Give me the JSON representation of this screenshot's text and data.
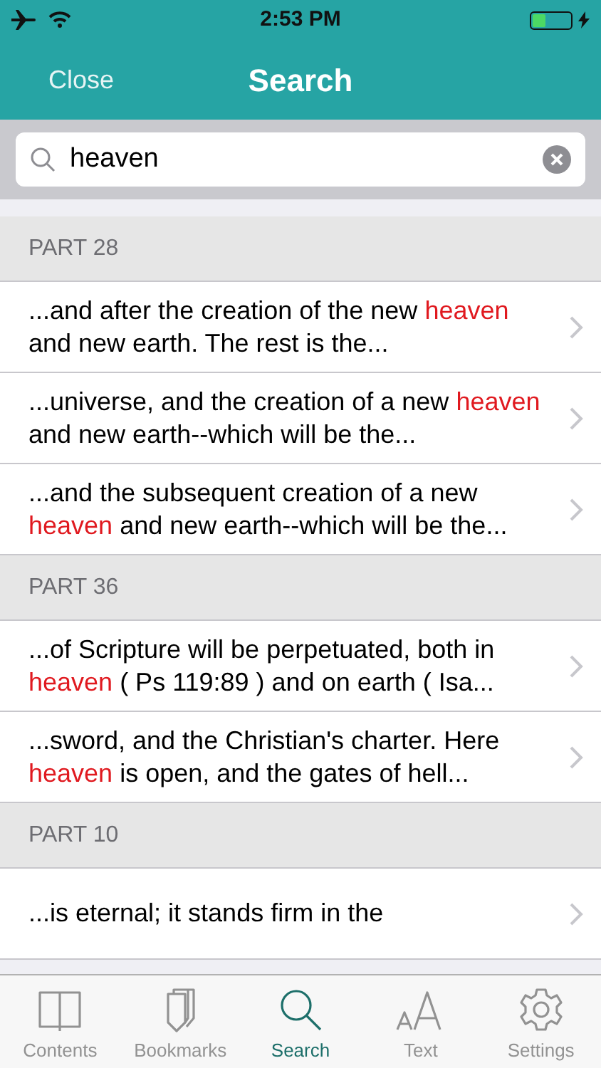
{
  "status_bar": {
    "time": "2:53 PM"
  },
  "nav": {
    "close": "Close",
    "title": "Search"
  },
  "search": {
    "value": "heaven"
  },
  "sections": [
    {
      "header": "PART 28",
      "results": [
        {
          "segments": [
            {
              "text": "...and after the creation of the new ",
              "highlight": false
            },
            {
              "text": "heaven",
              "highlight": true
            },
            {
              "text": " and new earth. The rest is the...",
              "highlight": false
            }
          ]
        },
        {
          "segments": [
            {
              "text": "...universe, and the creation of a new ",
              "highlight": false
            },
            {
              "text": "heaven",
              "highlight": true
            },
            {
              "text": " and new earth--which will be the...",
              "highlight": false
            }
          ]
        },
        {
          "segments": [
            {
              "text": "...and the subsequent creation of a new ",
              "highlight": false
            },
            {
              "text": "heaven",
              "highlight": true
            },
            {
              "text": " and new earth--which will be the...",
              "highlight": false
            }
          ]
        }
      ]
    },
    {
      "header": "PART 36",
      "results": [
        {
          "segments": [
            {
              "text": "...of Scripture will be perpetuated, both in ",
              "highlight": false
            },
            {
              "text": "heaven",
              "highlight": true
            },
            {
              "text": " ( Ps 119:89 ) and on earth ( Isa...",
              "highlight": false
            }
          ]
        },
        {
          "segments": [
            {
              "text": "...sword, and the Christian's charter. Here ",
              "highlight": false
            },
            {
              "text": "heaven",
              "highlight": true
            },
            {
              "text": " is open, and the gates of hell...",
              "highlight": false
            }
          ]
        }
      ]
    },
    {
      "header": "PART 10",
      "results": [
        {
          "segments": [
            {
              "text": "...is eternal; it stands firm in the",
              "highlight": false
            }
          ]
        }
      ]
    }
  ],
  "tabs": [
    {
      "label": "Contents",
      "kind": "book",
      "selected": false
    },
    {
      "label": "Bookmarks",
      "kind": "bookmarks",
      "selected": false
    },
    {
      "label": "Search",
      "kind": "search",
      "selected": true
    },
    {
      "label": "Text",
      "kind": "text",
      "selected": false
    },
    {
      "label": "Settings",
      "kind": "gear",
      "selected": false
    }
  ]
}
